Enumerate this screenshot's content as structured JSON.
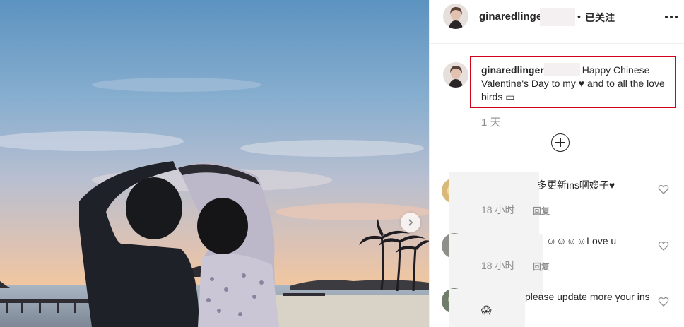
{
  "post": {
    "username": "ginaredlinger",
    "follow_separator": "•",
    "follow_label": "已关注",
    "caption_user": "ginaredlinger",
    "caption_text": "Happy Chinese Valentine's Day to my ♥ and to all the love birds ▭",
    "caption_time": "1 天"
  },
  "comments": [
    {
      "text": "多更新ins啊嫂子♥",
      "time": "18 小时",
      "reply": "回复"
    },
    {
      "text": "☺☺☺☺Love u",
      "time": "18 小时",
      "reply": "回复"
    },
    {
      "text": "please update more your ins 😱"
    }
  ],
  "icons": {
    "more": "more-options-icon",
    "next": "chevron-right-icon",
    "load_more": "plus-circle-icon",
    "like": "heart-outline-icon"
  },
  "colors": {
    "highlight_border": "#d0021b",
    "secondary_text": "#8e8e8e",
    "primary_text": "#262626"
  }
}
